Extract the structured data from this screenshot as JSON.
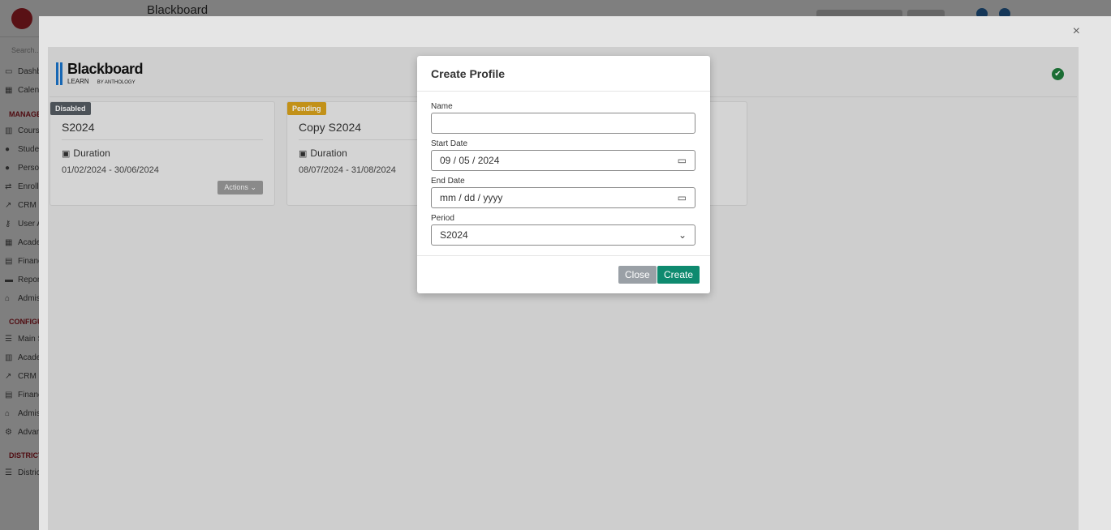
{
  "app": {
    "title": "Blackboard",
    "sidebar": {
      "search_placeholder": "Search...",
      "items": [
        {
          "icon": "laptop-icon",
          "label": "Dashb"
        },
        {
          "icon": "calendar-icon",
          "label": "Calen"
        },
        {
          "section": "MANAGE"
        },
        {
          "icon": "courses-icon",
          "label": "Cours"
        },
        {
          "icon": "students-icon",
          "label": "Stude"
        },
        {
          "icon": "person-icon",
          "label": "Perso"
        },
        {
          "icon": "enroll-icon",
          "label": "Enroll"
        },
        {
          "icon": "crm-icon",
          "label": "CRM"
        },
        {
          "icon": "key-icon",
          "label": "User A"
        },
        {
          "icon": "grid-icon",
          "label": "Acade"
        },
        {
          "icon": "finance-icon",
          "label": "Financ"
        },
        {
          "icon": "print-icon",
          "label": "Repor"
        },
        {
          "icon": "bank-icon",
          "label": "Admis"
        },
        {
          "section": "CONFIGU"
        },
        {
          "icon": "sliders-icon",
          "label": "Main S"
        },
        {
          "icon": "courses-icon",
          "label": "Acade"
        },
        {
          "icon": "crm-icon",
          "label": "CRM S"
        },
        {
          "icon": "finance-icon",
          "label": "Financ"
        },
        {
          "icon": "bank-icon",
          "label": "Admis"
        },
        {
          "icon": "cogs-icon",
          "label": "Advan"
        },
        {
          "section": "DISTRICT"
        },
        {
          "icon": "list-icon",
          "label": "Distric"
        }
      ]
    }
  },
  "modal": {
    "close_glyph": "×",
    "logo": {
      "title": "Blackboard",
      "subtitle": "LEARN",
      "subtitle_small": "BY ANTHOLOGY"
    },
    "status_glyph": "✔",
    "cards": [
      {
        "badge": "Disabled",
        "badge_color": "#555c63",
        "title": "S2024",
        "duration_label": "Duration",
        "dates": "01/02/2024 - 30/06/2024",
        "actions_label": "Actions"
      },
      {
        "badge": "Pending",
        "badge_color": "#d9a21b",
        "title": "Copy S2024",
        "duration_label": "Duration",
        "dates": "08/07/2024 - 31/08/2024"
      }
    ]
  },
  "dialog": {
    "title": "Create Profile",
    "name_label": "Name",
    "name_value": "",
    "start_label": "Start Date",
    "start_value": "09 / 05 / 2024",
    "end_label": "End Date",
    "end_value": "mm / dd / yyyy",
    "period_label": "Period",
    "period_value": "S2024",
    "close_label": "Close",
    "create_label": "Create"
  },
  "colors": {
    "accent": "#0e8a6f",
    "brand": "#b3222a",
    "success": "#1f7a3a"
  }
}
